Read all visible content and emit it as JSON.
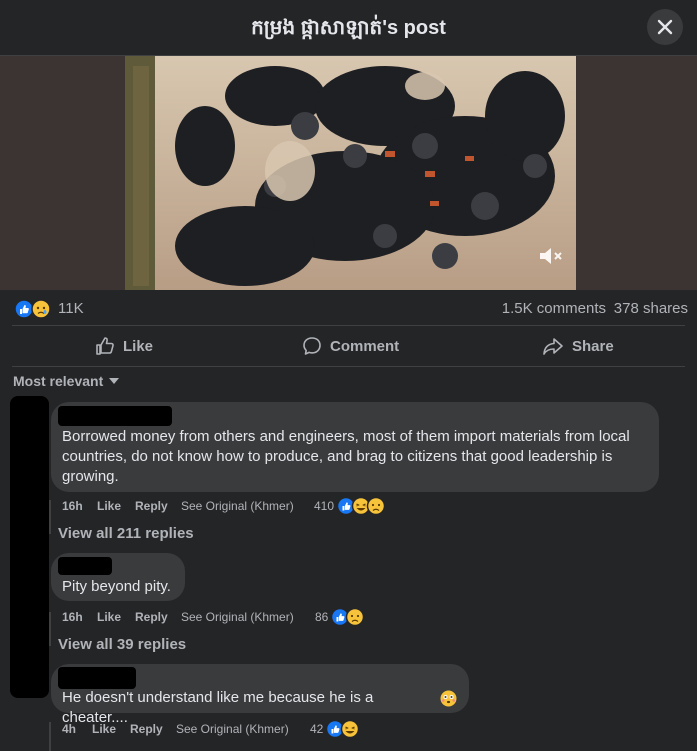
{
  "header": {
    "title": "កម្រង ផ្កាសាឡាត់'s post"
  },
  "stats": {
    "reactions": "11K",
    "comments": "1.5K comments",
    "shares": "378 shares"
  },
  "actions": {
    "like": "Like",
    "comment": "Comment",
    "share": "Share"
  },
  "sort": {
    "label": "Most relevant"
  },
  "comments": [
    {
      "text": "Borrowed money from others and engineers, most of them import materials from local countries, do not know how to produce, and brag to citizens that good leadership is growing.",
      "time": "16h",
      "like": "Like",
      "reply": "Reply",
      "see_original": "See Original (Khmer)",
      "reaction_count": "410",
      "view_replies": "View all 211 replies"
    },
    {
      "text": "Pity beyond pity.",
      "time": "16h",
      "like": "Like",
      "reply": "Reply",
      "see_original": "See Original (Khmer)",
      "reaction_count": "86",
      "view_replies": "View all 39 replies"
    },
    {
      "text": "He doesn't understand like me because he is a cheater....",
      "time": "4h",
      "like": "Like",
      "reply": "Reply",
      "see_original": "See Original (Khmer)",
      "reaction_count": "42"
    }
  ],
  "colors": {
    "like_blue": "#1877f2",
    "reaction_yellow": "#f7c33b",
    "background": "#242526",
    "bubble": "#3a3b3c"
  },
  "icons": {
    "close": "close-icon",
    "mute": "muted-speaker-icon",
    "like": "thumbs-up-icon",
    "comment": "speech-bubble-icon",
    "share": "share-arrow-icon"
  }
}
